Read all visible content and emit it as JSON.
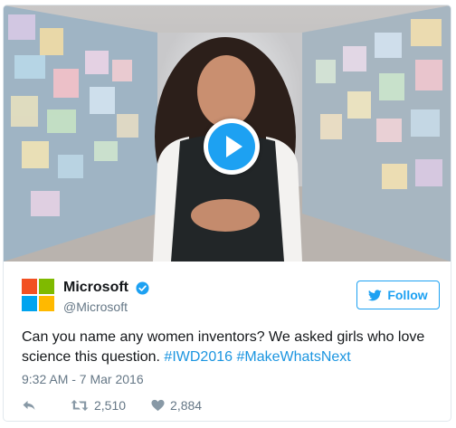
{
  "tweet": {
    "display_name": "Microsoft",
    "handle": "@Microsoft",
    "text_plain": "Can you name any women inventors? We asked girls who love science this question. ",
    "hashtags": [
      "#IWD2016",
      "#MakeWhatsNext"
    ],
    "timestamp": "9:32 AM - 7 Mar 2016"
  },
  "follow": {
    "label": "Follow"
  },
  "actions": {
    "retweets": "2,510",
    "likes": "2,884"
  },
  "media": {
    "type": "video",
    "play_icon": "play-icon"
  },
  "colors": {
    "accent": "#1da1f2",
    "hashtag": "#1b95e0",
    "logo_red": "#f25022",
    "logo_green": "#7fba00",
    "logo_blue": "#00a4ef",
    "logo_yellow": "#ffb900"
  },
  "icons": {
    "verified": "verified-badge-icon",
    "follow": "twitter-bird-icon",
    "reply": "reply-icon",
    "retweet": "retweet-icon",
    "like": "heart-icon"
  }
}
